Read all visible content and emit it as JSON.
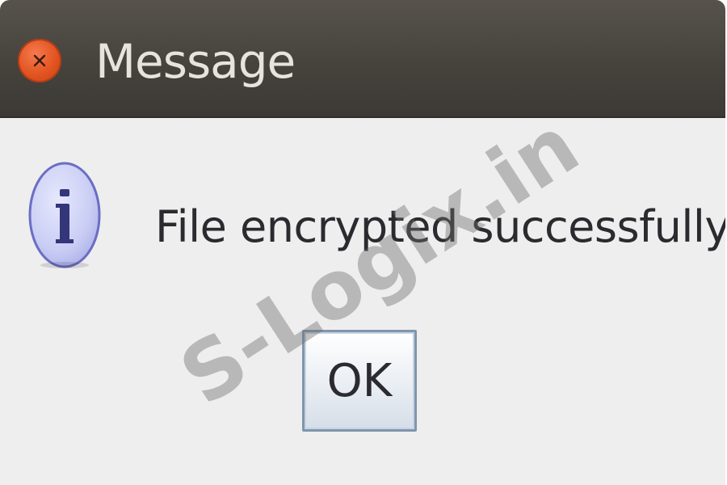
{
  "window": {
    "title": "Message",
    "close_icon": "close-icon"
  },
  "dialog": {
    "icon": "info-icon",
    "message": "File encrypted successfully.",
    "ok_label": "OK"
  },
  "watermark": {
    "text": "S-Logix.in"
  },
  "colors": {
    "titlebar": "#46433d",
    "close_button": "#e2531f",
    "dialog_background": "#efeeee",
    "info_icon_fill": "#c9cdf4",
    "info_icon_stroke": "#5b5fb8"
  }
}
